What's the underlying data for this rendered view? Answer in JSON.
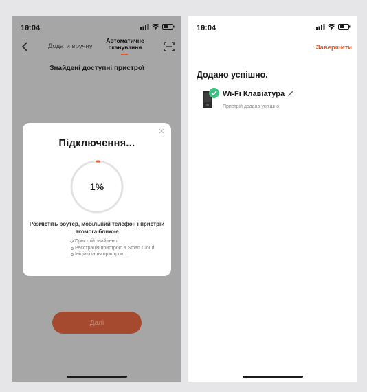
{
  "left_screen": {
    "status": {
      "time": "10:04"
    },
    "nav": {
      "back_icon": "chevron-left-icon",
      "tab_manual": "Додати вручну",
      "tab_auto": "Автоматичне сканування",
      "scan_icon": "scan-frame-icon"
    },
    "found_title": "Знайдені доступні пристрої",
    "modal": {
      "title": "Підключення...",
      "progress": 1,
      "progress_label": "1%",
      "message": "Розмістіть роутер, мобільний телефон і пристрій якомога ближче",
      "steps": [
        {
          "state": "done",
          "label": "Пристрій знайдено"
        },
        {
          "state": "pending",
          "label": "Реєстрація пристрою в Smart Cloud"
        },
        {
          "state": "pending",
          "label": "Ініціалізація пристрою..."
        }
      ]
    },
    "next_button": "Далі"
  },
  "right_screen": {
    "status": {
      "time": "10:04"
    },
    "finish_link": "Завершити",
    "added_title": "Додано успішно.",
    "device": {
      "name": "Wi-Fi Клавіатура",
      "status": "Пристрій додано успішно"
    }
  },
  "colors": {
    "accent": "#e35a28",
    "success": "#3fbf7f",
    "overlay": "#a6a6a6",
    "button_dim": "#a64a2f"
  }
}
